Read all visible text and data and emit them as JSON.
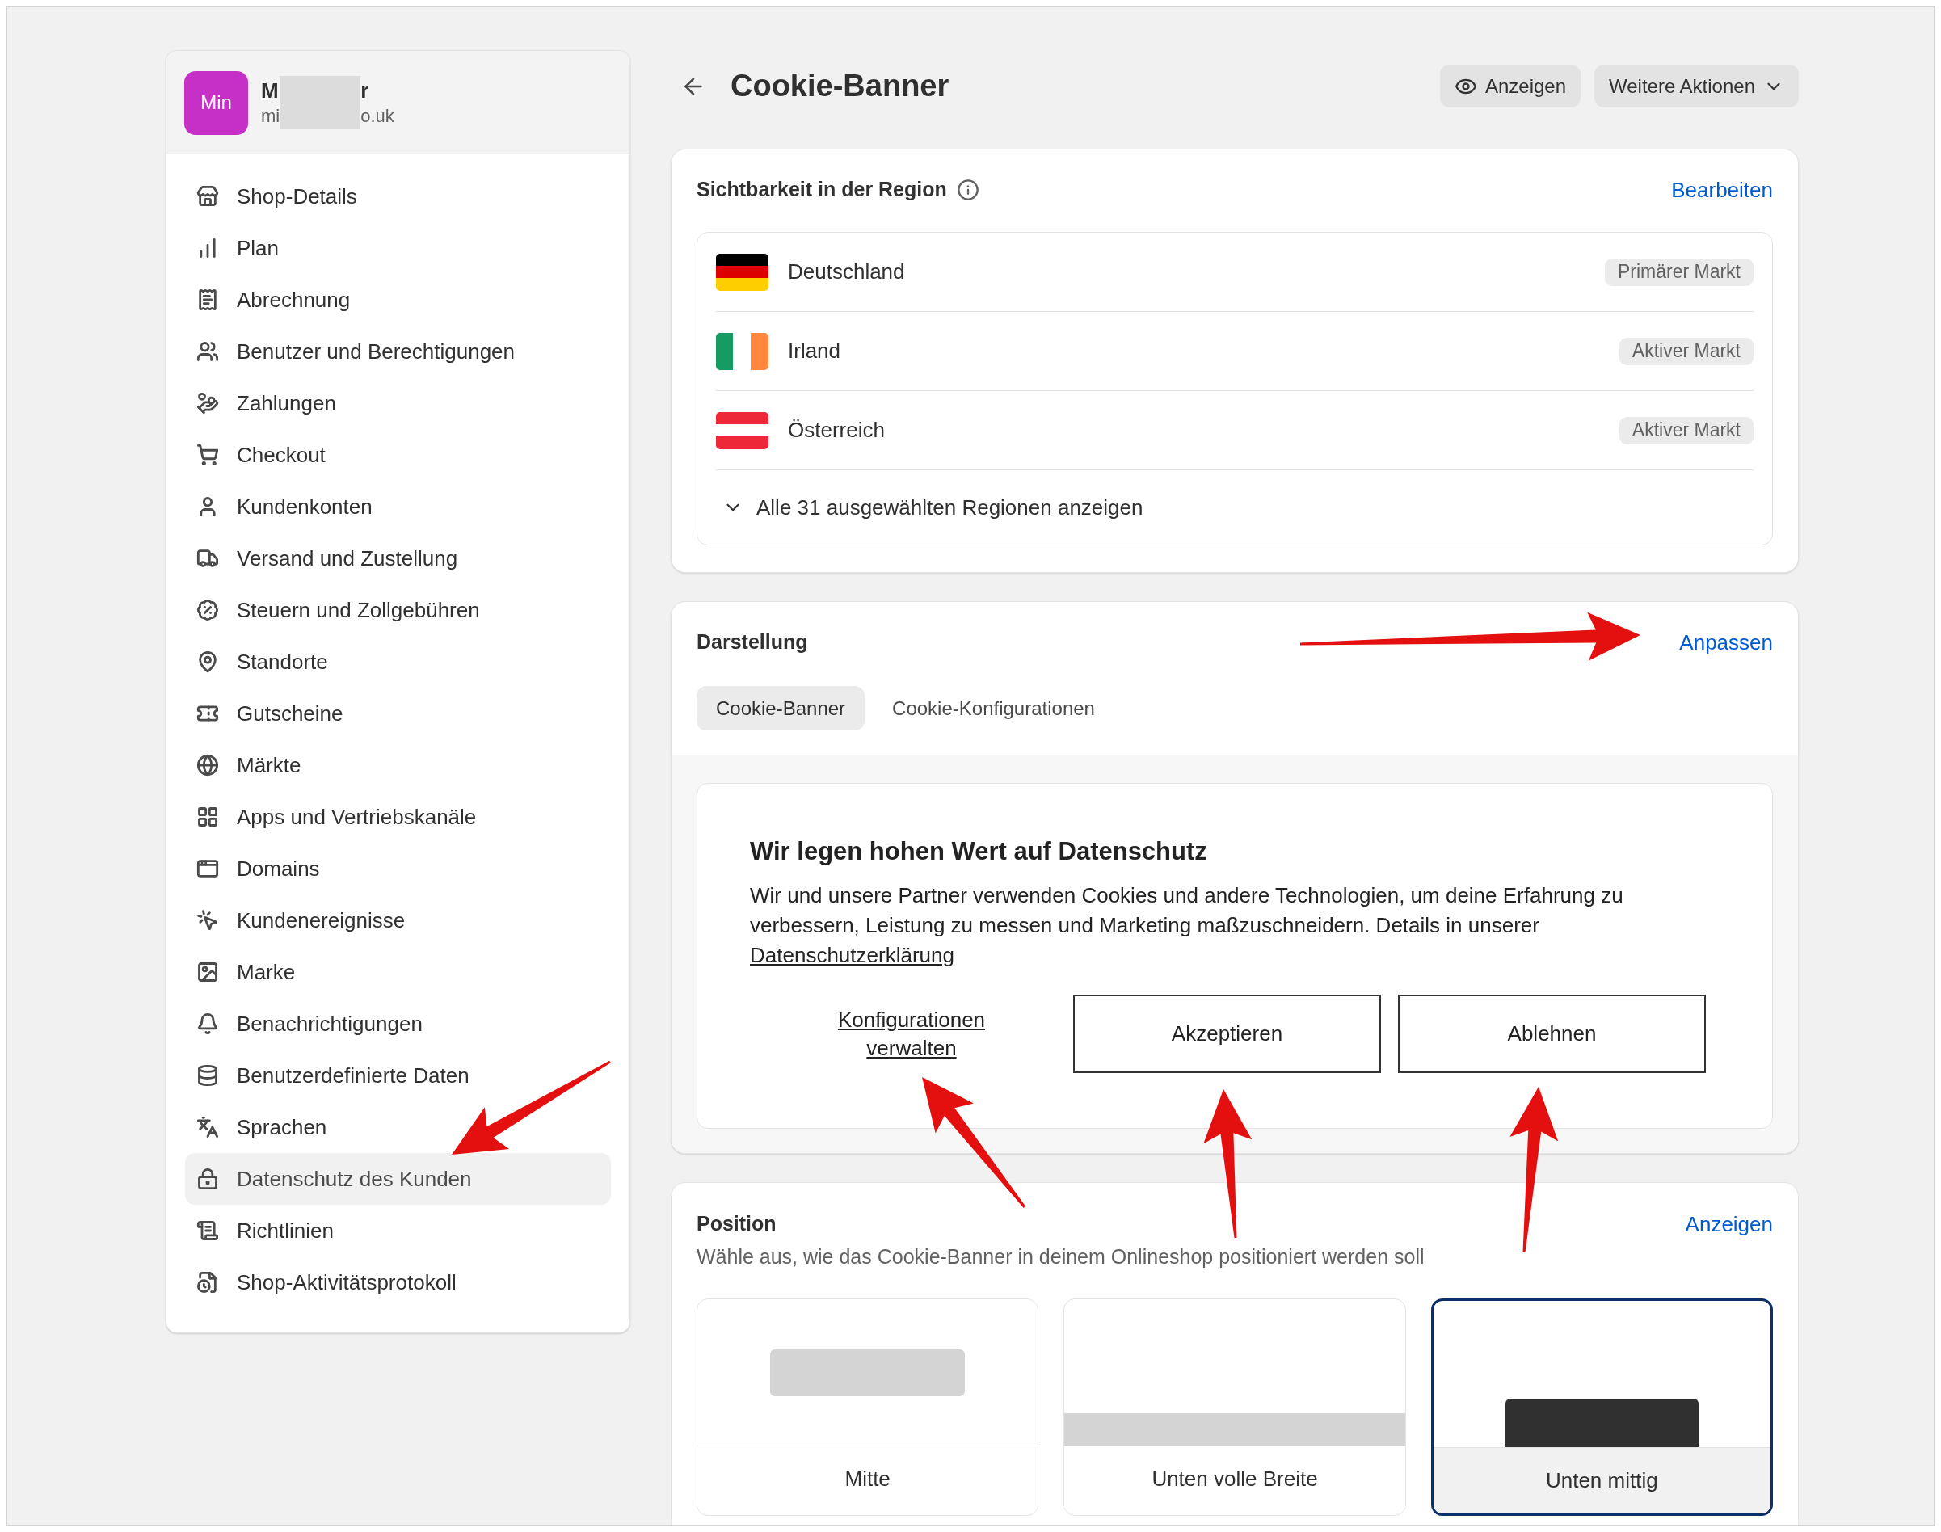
{
  "store": {
    "avatar": "Min",
    "name_start": "M",
    "name_end": "r",
    "email_start": "mi",
    "email_end": "o.uk"
  },
  "sidebar": {
    "items": [
      {
        "label": "Shop-Details",
        "selected": false
      },
      {
        "label": "Plan",
        "selected": false
      },
      {
        "label": "Abrechnung",
        "selected": false
      },
      {
        "label": "Benutzer und Berechtigungen",
        "selected": false
      },
      {
        "label": "Zahlungen",
        "selected": false
      },
      {
        "label": "Checkout",
        "selected": false
      },
      {
        "label": "Kundenkonten",
        "selected": false
      },
      {
        "label": "Versand und Zustellung",
        "selected": false
      },
      {
        "label": "Steuern und Zollgebühren",
        "selected": false
      },
      {
        "label": "Standorte",
        "selected": false
      },
      {
        "label": "Gutscheine",
        "selected": false
      },
      {
        "label": "Märkte",
        "selected": false
      },
      {
        "label": "Apps und Vertriebskanäle",
        "selected": false
      },
      {
        "label": "Domains",
        "selected": false
      },
      {
        "label": "Kundenereignisse",
        "selected": false
      },
      {
        "label": "Marke",
        "selected": false
      },
      {
        "label": "Benachrichtigungen",
        "selected": false
      },
      {
        "label": "Benutzerdefinierte Daten",
        "selected": false
      },
      {
        "label": "Sprachen",
        "selected": false
      },
      {
        "label": "Datenschutz des Kunden",
        "selected": true
      },
      {
        "label": "Richtlinien",
        "selected": false
      },
      {
        "label": "Shop-Aktivitätsprotokoll",
        "selected": false
      }
    ]
  },
  "header": {
    "title": "Cookie-Banner",
    "buttons": [
      "Anzeigen",
      "Weitere Aktionen"
    ]
  },
  "visibility": {
    "title": "Sichtbarkeit in der Region",
    "action": "Bearbeiten",
    "regions": [
      {
        "name": "Deutschland",
        "badge": "Primärer Markt"
      },
      {
        "name": "Irland",
        "badge": "Aktiver Markt"
      },
      {
        "name": "Österreich",
        "badge": "Aktiver Markt"
      }
    ],
    "show_all": "Alle 31 ausgewählten Regionen anzeigen"
  },
  "appearance": {
    "title": "Darstellung",
    "action": "Anpassen",
    "tabs": [
      {
        "label": "Cookie-Banner",
        "selected": true
      },
      {
        "label": "Cookie-Konfigurationen",
        "selected": false
      }
    ],
    "preview": {
      "heading": "Wir legen hohen Wert auf Datenschutz",
      "body": "Wir und unsere Partner verwenden Cookies und andere Technologien, um deine Erfahrung zu verbessern, Leistung zu messen und Marketing maßzuschneidern. Details in unserer",
      "policy_link": "Datenschutzerklärung",
      "manage_link": "Konfigurationen verwalten",
      "buttons": [
        "Akzeptieren",
        "Ablehnen"
      ]
    }
  },
  "position": {
    "title": "Position",
    "action": "Anzeigen",
    "subtitle": "Wähle aus, wie das Cookie-Banner in deinem Onlineshop positioniert werden soll",
    "options": [
      {
        "label": "Mitte",
        "kind": "center",
        "selected": false
      },
      {
        "label": "Unten volle Breite",
        "kind": "bottom-full",
        "selected": false
      },
      {
        "label": "Unten mittig",
        "kind": "bottom-center",
        "selected": true
      }
    ]
  }
}
